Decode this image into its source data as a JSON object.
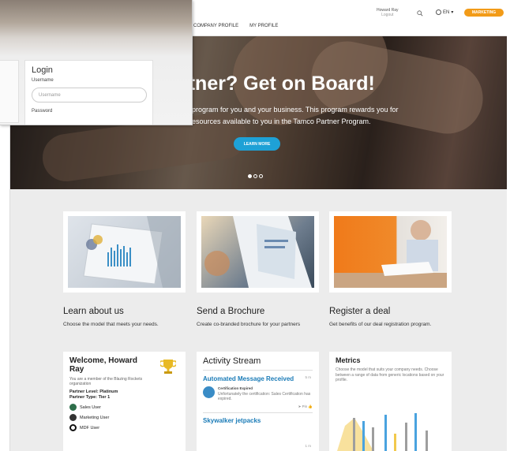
{
  "header": {
    "nav": [
      "COMPANY PROFILE",
      "MY PROFILE"
    ],
    "account_name": "Howard Ray",
    "account_sub": "Logout",
    "language": "EN",
    "cta_label": "MARKETING"
  },
  "hero": {
    "title": "rtner? Get on Board!",
    "line1": "program for you and your business. This program rewards you for",
    "line2": "esources available to you in the Tamco Partner Program.",
    "button": "LEARN MORE",
    "slides": 3,
    "active_slide": 1
  },
  "tiles": [
    {
      "title": "Learn about us",
      "desc": "Choose the model that meets your needs."
    },
    {
      "title": "Send a Brochure",
      "desc": "Create co-branded brochure for your partners"
    },
    {
      "title": "Register a deal",
      "desc": "Get benefits of our deal registration program."
    }
  ],
  "welcome": {
    "title": "Welcome, Howard Ray",
    "member_text": "You are a member of the Blazing Rockets organization",
    "level": "Partner Level: Platinum",
    "tier": "Partner Type: Tier 1",
    "roles": [
      "Sales User",
      "Marketing User",
      "MDF User"
    ]
  },
  "activity": {
    "title": "Activity Stream",
    "items": [
      {
        "title": "Automated Message Received",
        "when": "5 m",
        "label": "Certification Expired",
        "message": "Unfortunately the certification: Sales Certification has expired.",
        "actions": "Pin"
      },
      {
        "title": "Skywalker jetpacks",
        "when": "1 m"
      }
    ]
  },
  "metrics": {
    "title": "Metrics",
    "text": "Choose the model that suits your company needs. Choose between a range of data from generic locations based on your profile.",
    "colors": [
      "#f2c94c",
      "#9e9e9e",
      "#4aa3df"
    ]
  }
}
